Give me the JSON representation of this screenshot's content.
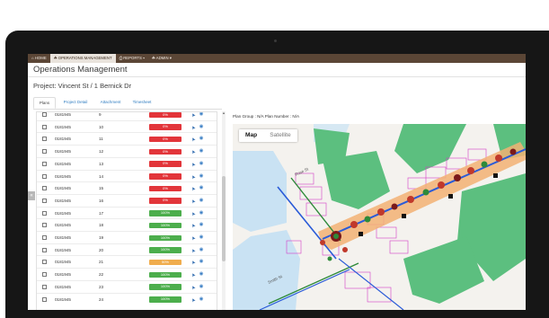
{
  "navbar": {
    "items": [
      {
        "icon": "home-icon",
        "label": "⌂ HOME"
      },
      {
        "icon": "users-icon",
        "label": "☘ OPERATIONS MANAGEMENT"
      },
      {
        "icon": "report-icon",
        "label": "⎙ REPORTS ▾"
      },
      {
        "icon": "admin-icon",
        "label": "☘ ADMIN ▾"
      }
    ]
  },
  "app_title": "Operations Management",
  "project_title": "Project: Vincent St / 1 Bernick Dr",
  "tabs": [
    "Plans",
    "Project Detail",
    "Attachment",
    "Timesheet"
  ],
  "plans": {
    "rows": [
      {
        "code": "0181945",
        "num": "9",
        "progress": "0%",
        "status": "red"
      },
      {
        "code": "0181945",
        "num": "10",
        "progress": "0%",
        "status": "red"
      },
      {
        "code": "0181945",
        "num": "11",
        "progress": "0%",
        "status": "red"
      },
      {
        "code": "0181945",
        "num": "12",
        "progress": "0%",
        "status": "red"
      },
      {
        "code": "0181945",
        "num": "13",
        "progress": "0%",
        "status": "red"
      },
      {
        "code": "0181945",
        "num": "14",
        "progress": "0%",
        "status": "red"
      },
      {
        "code": "0181945",
        "num": "15",
        "progress": "0%",
        "status": "red"
      },
      {
        "code": "0181945",
        "num": "16",
        "progress": "0%",
        "status": "red"
      },
      {
        "code": "0181945",
        "num": "17",
        "progress": "100%",
        "status": "green"
      },
      {
        "code": "0181945",
        "num": "18",
        "progress": "100%",
        "status": "green"
      },
      {
        "code": "0181945",
        "num": "19",
        "progress": "100%",
        "status": "green"
      },
      {
        "code": "0181945",
        "num": "20",
        "progress": "100%",
        "status": "green"
      },
      {
        "code": "0181945",
        "num": "21",
        "progress": "50%",
        "status": "orange"
      },
      {
        "code": "0181945",
        "num": "22",
        "progress": "100%",
        "status": "green"
      },
      {
        "code": "0181945",
        "num": "23",
        "progress": "100%",
        "status": "green"
      },
      {
        "code": "0181945",
        "num": "24",
        "progress": "100%",
        "status": "green"
      }
    ]
  },
  "map": {
    "plan_group_text": "Plan Group : N/A    Plan Number : N/A",
    "map_type_buttons": [
      "Map",
      "Satellite"
    ],
    "street_labels": [
      "Rose St",
      "Smith St"
    ]
  },
  "colors": {
    "navbar": "#5b4636",
    "red": "#e2353a",
    "green": "#4cae4c",
    "orange": "#f0ad4e",
    "park": "#5cbf7f",
    "road": "#f5f4ee",
    "block": "#c9e2f3"
  }
}
